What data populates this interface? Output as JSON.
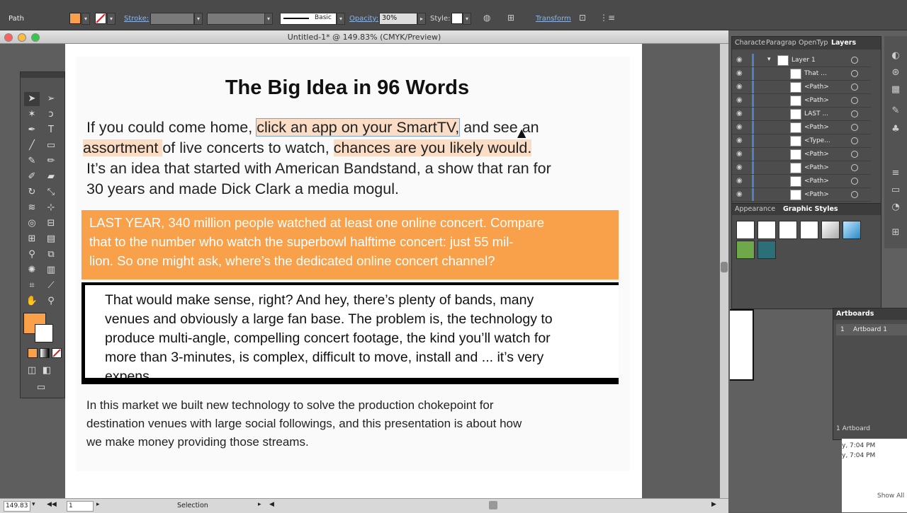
{
  "control_bar": {
    "object_type": "Path",
    "fill_color": "#f9a04a",
    "stroke_label": "Stroke:",
    "brush_label": "Basic",
    "opacity_label": "Opacity:",
    "opacity_value": "30%",
    "style_label": "Style:",
    "transform_label": "Transform"
  },
  "document": {
    "window_title": "Untitled-1* @ 149.83% (CMYK/Preview)",
    "heading": "The Big Idea in 96 Words",
    "para1": {
      "l1a": "If you could come home, ",
      "l1b": "click an app on your SmartTV,",
      "l1c": " and see an",
      "l2a": "assortment ",
      "l2b": "of live concerts to watch, ",
      "l2c": "chances are you likely would.",
      "l3": "It’s an idea that started with American Bandstand, a show that ran for",
      "l4": "30 years and made Dick Clark a media mogul."
    },
    "orange_block": [
      "LAST YEAR, 340 million people watched at least one online concert. Compare",
      "that to the number who watch the superbowl halftime concert: just 55 mil-",
      "lion. So one might ask, where’s the dedicated online concert channel?"
    ],
    "black_block": [
      "That would make sense, right? And hey, there’s plenty of bands, many",
      "venues and obviously a large fan base. The problem is, the technology to",
      "produce multi-angle, compelling concert footage, the kind you’ll watch for",
      "more than 3-minutes, is complex,  difficult to move, install and ... it’s very",
      "expens"
    ],
    "bottom_para": [
      "In this market we built new technology to solve the production chokepoint for",
      "destination venues with large social followings, and this presentation is about how",
      "we make money providing those streams."
    ]
  },
  "status_bar": {
    "zoom": "149.83",
    "artboard_num": "1",
    "tool_name": "Selection"
  },
  "layers_panel": {
    "tabs": [
      "Characte",
      "Paragrap",
      "OpenTyp",
      "Layers"
    ],
    "layer_name": "Layer 1",
    "items": [
      "That ...",
      "<Path>",
      "<Path>",
      "LAST ...",
      "<Path>",
      "<Type...",
      "<Path>",
      "<Path>",
      "<Path>",
      "<Path>"
    ]
  },
  "graphic_styles_panel": {
    "tabs": [
      "Appearance",
      "Graphic Styles"
    ]
  },
  "artboards_panel": {
    "title": "Artboards",
    "row_index": "1",
    "row_name": "Artboard 1",
    "footer": "1 Artboard"
  },
  "background_window": {
    "times": [
      "y, 7:04 PM",
      "y, 7:04 PM"
    ],
    "button": "Show All"
  }
}
